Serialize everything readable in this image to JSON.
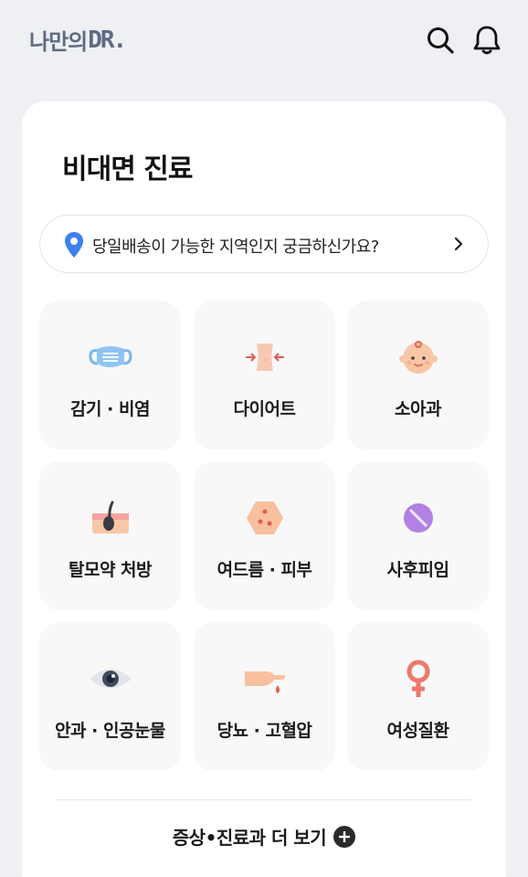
{
  "header": {
    "logo_text": "나만의",
    "logo_mark": "DR.",
    "icons": [
      "search-icon",
      "bell-icon"
    ]
  },
  "main": {
    "title": "비대면 진료",
    "location_prompt": "당일배송이 가능한 지역인지 궁금하신가요?",
    "categories": [
      {
        "label": "감기 · 비염",
        "icon": "mask-icon"
      },
      {
        "label": "다이어트",
        "icon": "waist-icon"
      },
      {
        "label": "소아과",
        "icon": "baby-icon"
      },
      {
        "label": "탈모약 처방",
        "icon": "hair-follicle-icon"
      },
      {
        "label": "여드름 · 피부",
        "icon": "skin-acne-icon"
      },
      {
        "label": "사후피임",
        "icon": "pill-icon"
      },
      {
        "label": "안과 · 인공눈물",
        "icon": "eye-icon"
      },
      {
        "label": "당뇨 · 고혈압",
        "icon": "blood-drop-hand-icon"
      },
      {
        "label": "여성질환",
        "icon": "female-symbol-icon"
      }
    ],
    "more_label": "증상•진료과 더 보기"
  },
  "colors": {
    "background": "#eef0f4",
    "logo": "#5e6b82",
    "pin": "#3d7ff0"
  }
}
